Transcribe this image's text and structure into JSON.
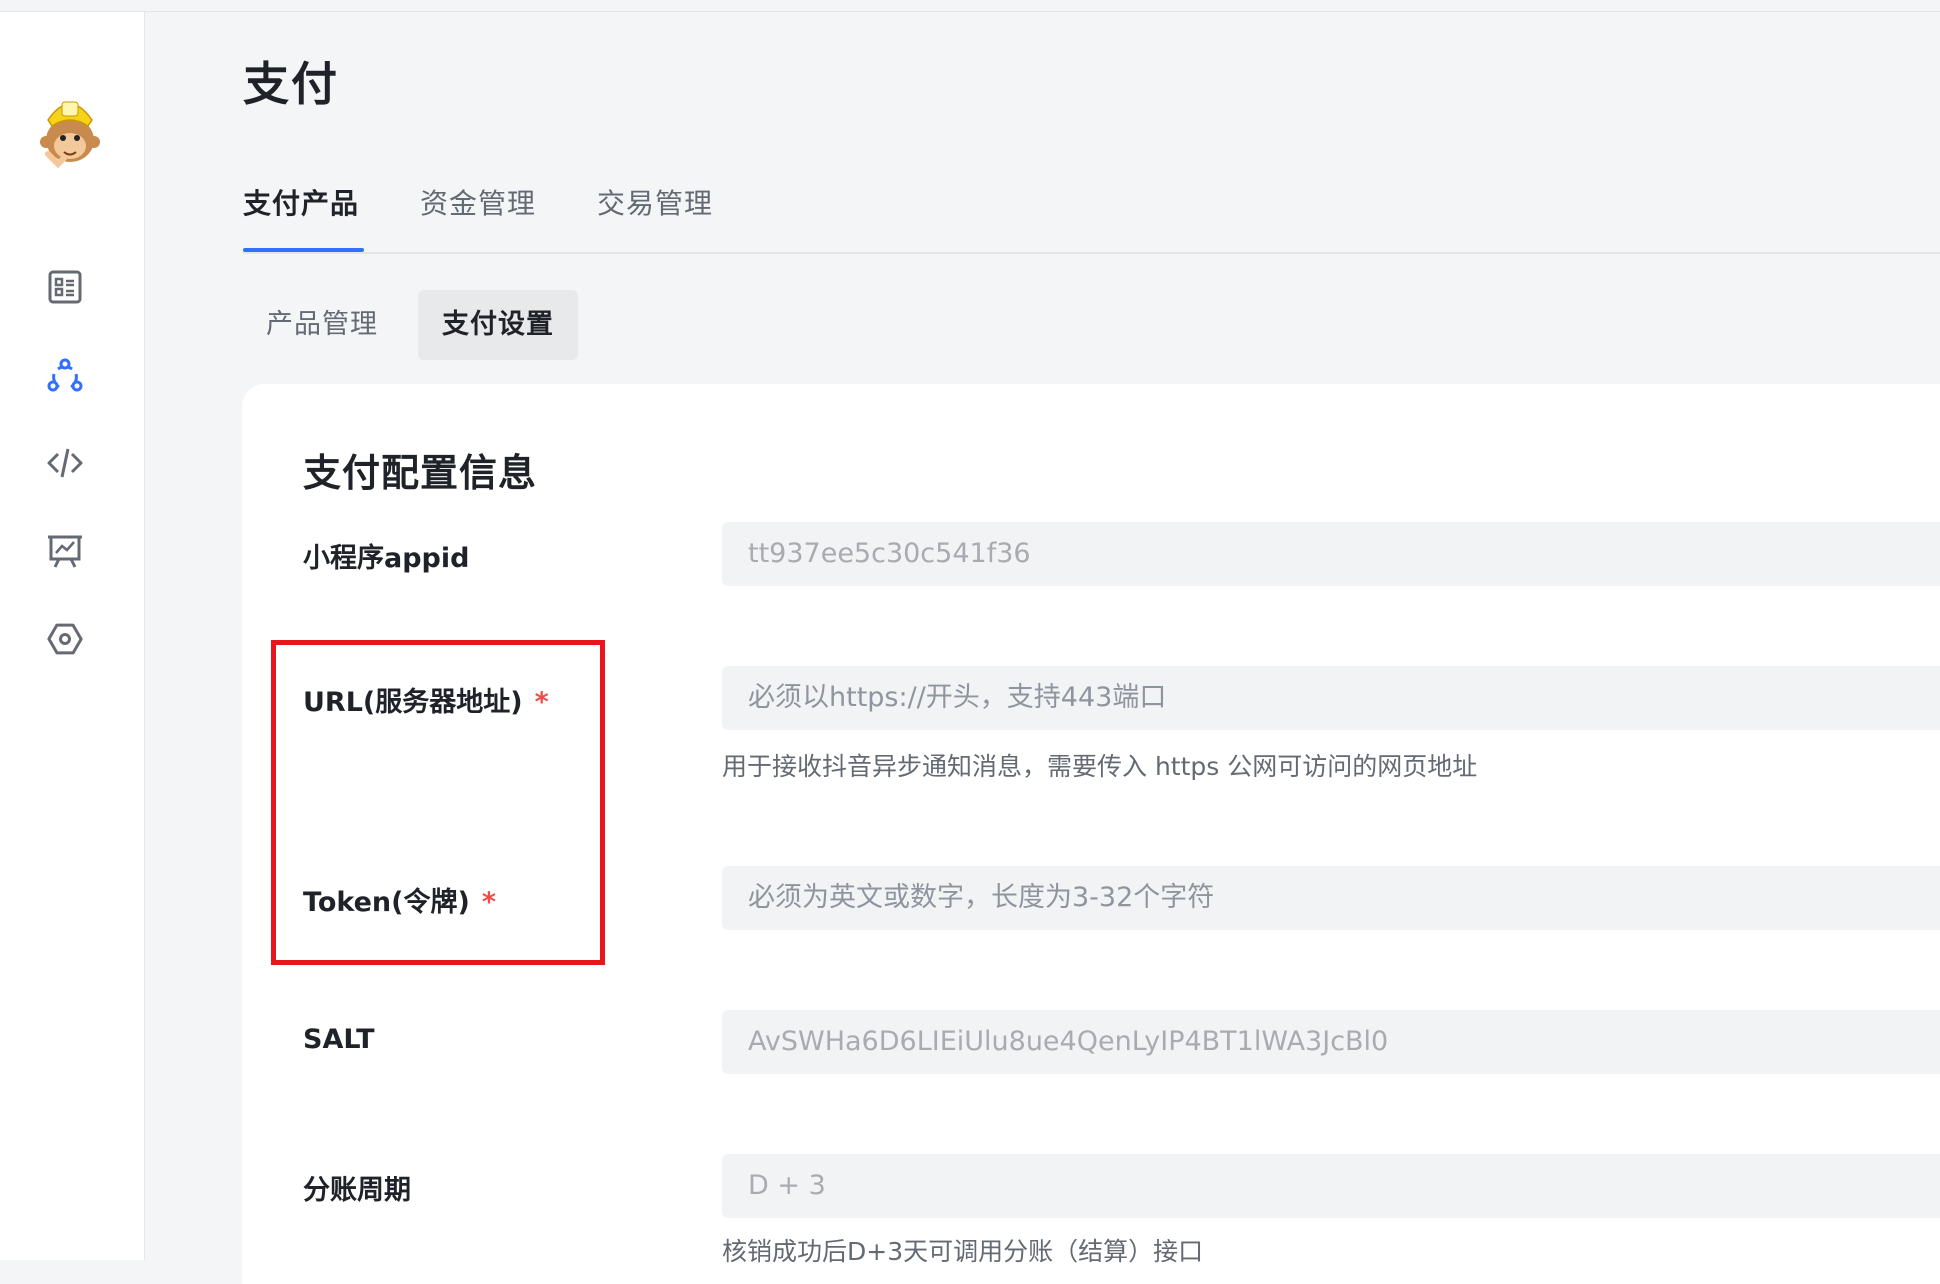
{
  "page": {
    "title": "支付"
  },
  "tabs": [
    {
      "label": "支付产品",
      "active": true
    },
    {
      "label": "资金管理",
      "active": false
    },
    {
      "label": "交易管理",
      "active": false
    }
  ],
  "subtabs": [
    {
      "label": "产品管理",
      "active": false
    },
    {
      "label": "支付设置",
      "active": true
    }
  ],
  "card": {
    "title": "支付配置信息",
    "fields": {
      "appid": {
        "label": "小程序appid",
        "value": "tt937ee5c30c541f36"
      },
      "url": {
        "label": "URL(服务器地址)",
        "required": "*",
        "placeholder": "必须以https://开头，支持443端口",
        "help": "用于接收抖音异步通知消息，需要传入 https 公网可访问的网页地址"
      },
      "token": {
        "label": "Token(令牌)",
        "required": "*",
        "placeholder": "必须为英文或数字，长度为3-32个字符"
      },
      "salt": {
        "label": "SALT",
        "value": "AvSWHa6D6LIEiUlu8ue4QenLyIP4BT1lWA3JcBl0"
      },
      "cycle": {
        "label": "分账周期",
        "value": "D + 3",
        "help": "核销成功后D+3天可调用分账（结算）接口"
      }
    }
  },
  "sidebar": {
    "icons": [
      "app-list-icon",
      "share-nodes-icon",
      "code-icon",
      "presentation-chart-icon",
      "settings-hexagon-icon"
    ]
  },
  "colors": {
    "accent": "#3370ff",
    "highlight": "#e8161b",
    "required": "#f54a45"
  }
}
